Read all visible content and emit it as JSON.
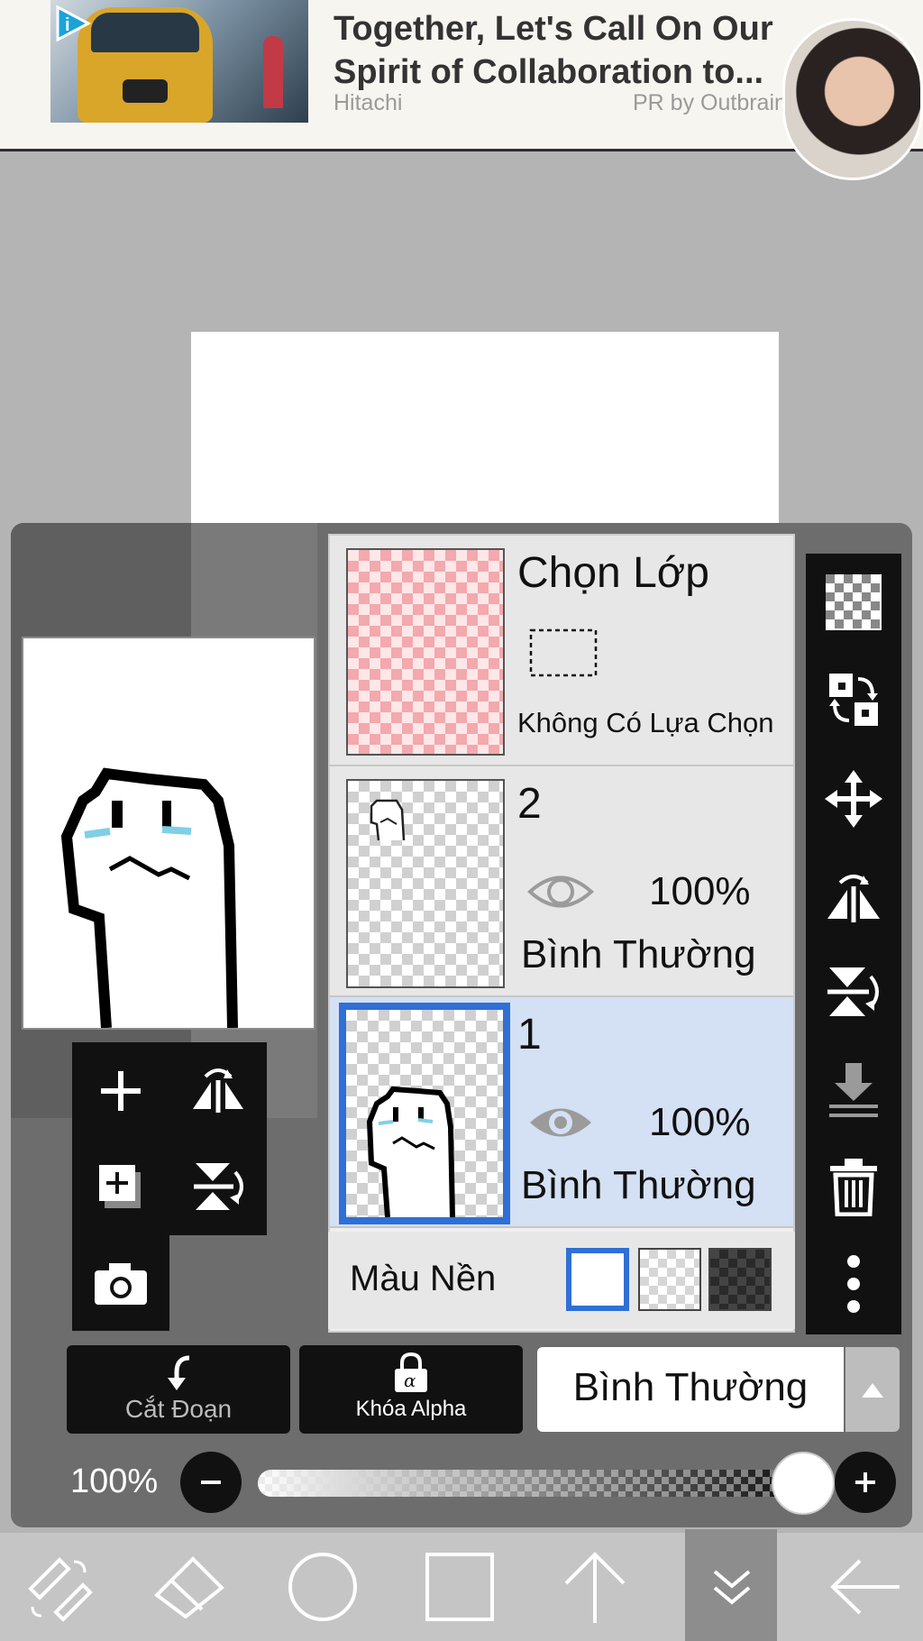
{
  "ad": {
    "headline_line1": "Together, Let's Call On Our",
    "headline_line2": "Spirit of Collaboration to...",
    "source": "Hitachi",
    "sponsor": "PR by Outbrain"
  },
  "colors": {
    "selected_border": "#2f6fd6",
    "selected_row_bg": "#d4e0f3",
    "panel_bg": "#6d6d6d",
    "toolbar_bg": "#111111"
  },
  "layers": {
    "selection_layer": {
      "title": "Chọn Lớp",
      "status": "Không Có Lựa Chọn"
    },
    "items": [
      {
        "name": "2",
        "opacity": "100%",
        "blend_mode": "Bình Thường",
        "visible": true,
        "selected": false
      },
      {
        "name": "1",
        "opacity": "100%",
        "blend_mode": "Bình Thường",
        "visible": true,
        "selected": true
      }
    ],
    "background": {
      "label": "Màu Nền",
      "options": [
        "white",
        "transparent",
        "dark-checker"
      ],
      "selected": "white"
    }
  },
  "controls": {
    "clip_label": "Cắt Đoạn",
    "alpha_lock_label": "Khóa Alpha",
    "blend_mode_value": "Bình Thường",
    "opacity_value": "100%",
    "opacity_fraction": 1.0
  },
  "side_tools": [
    "checker-layer-icon",
    "swap-layer-icon",
    "move-icon",
    "flip-horizontal-icon",
    "flip-vertical-icon",
    "merge-down-icon",
    "trash-icon",
    "more-icon"
  ],
  "bottom_nav": [
    "transform-tool-icon",
    "eraser-icon",
    "ellipse-icon",
    "rectangle-icon",
    "arrow-up-icon",
    "chevron-down-double-icon",
    "back-arrow-icon"
  ],
  "bottom_nav_selected": "chevron-down-double-icon"
}
